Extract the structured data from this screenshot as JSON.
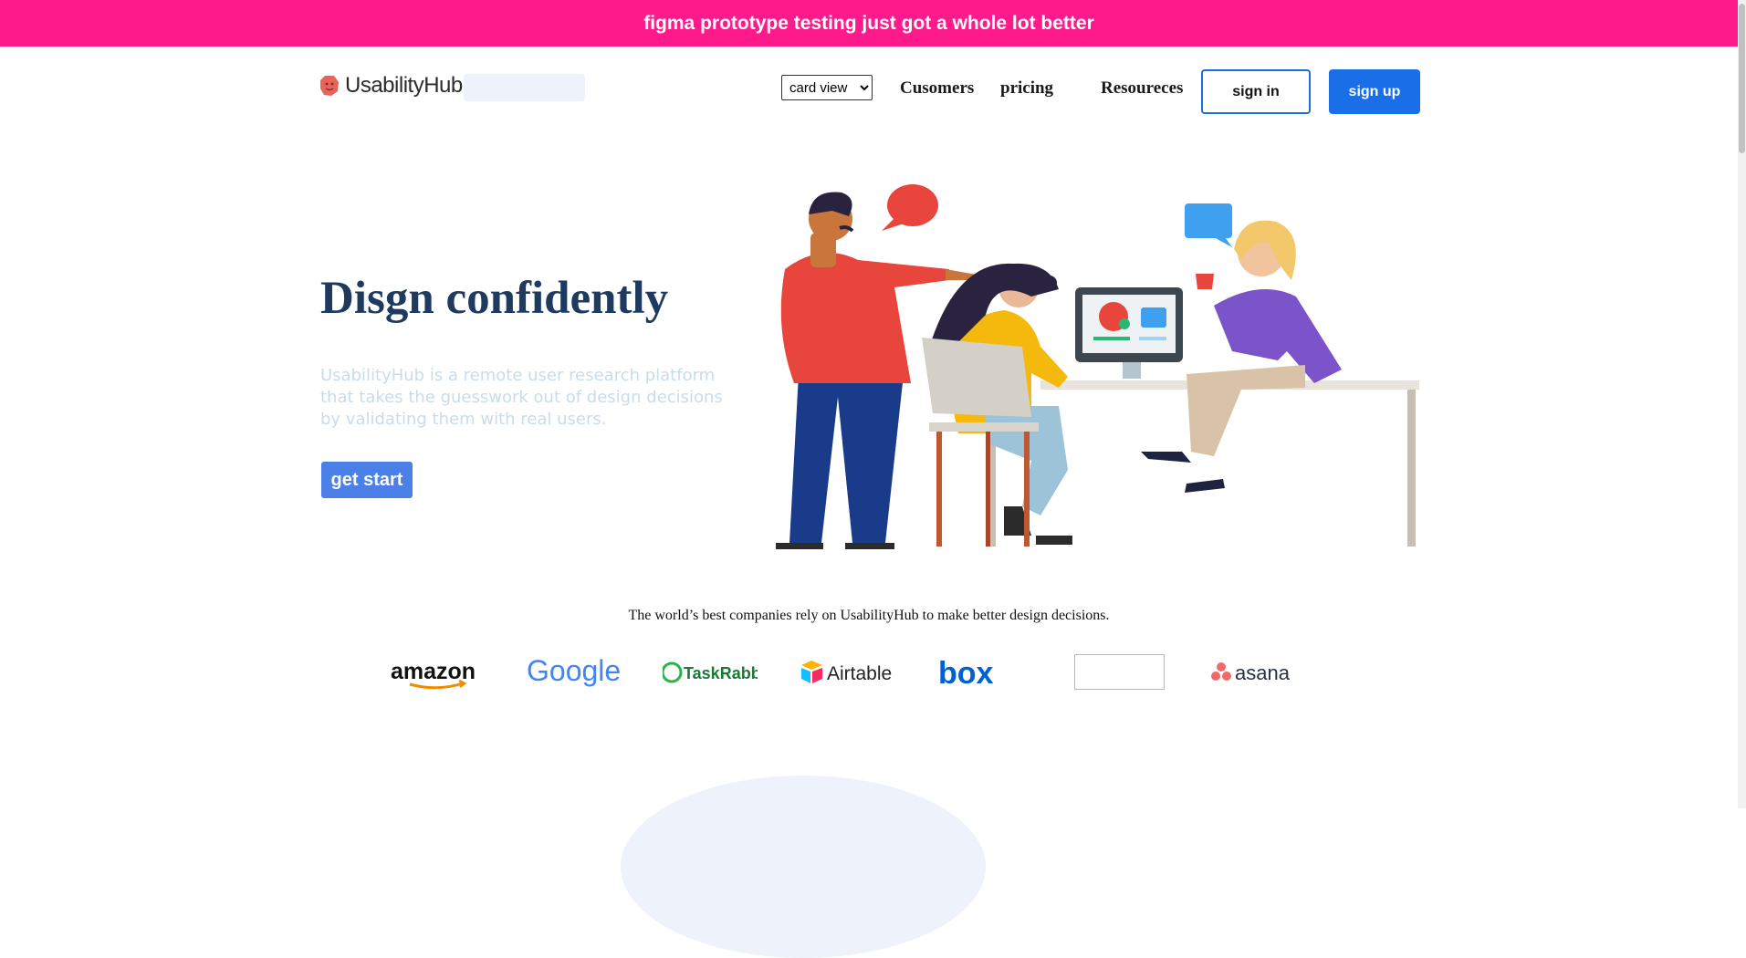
{
  "banner": {
    "text": "figma prototype testing just got a whole lot better",
    "color": "#ff1a8c"
  },
  "header": {
    "logo_text": "UsabilityHub",
    "view_select": {
      "selected": "card view",
      "options": [
        "card view"
      ]
    },
    "nav": [
      "Cusomers",
      "pricing",
      "Resoureces"
    ],
    "signin_label": "sign in",
    "signup_label": "sign up",
    "accent": "#1a6fe8"
  },
  "hero": {
    "title": "Disgn confidently",
    "description": "UsabilityHub is a remote user research platform that takes the guesswork out of design decisions by validating them with real users.",
    "cta_label": "get start"
  },
  "companies": {
    "text": "The world’s best companies rely on UsabilityHub to make better design decisions.",
    "logos": [
      "amazon",
      "Google",
      "TaskRabbit",
      "Airtable",
      "box",
      "asana"
    ]
  }
}
